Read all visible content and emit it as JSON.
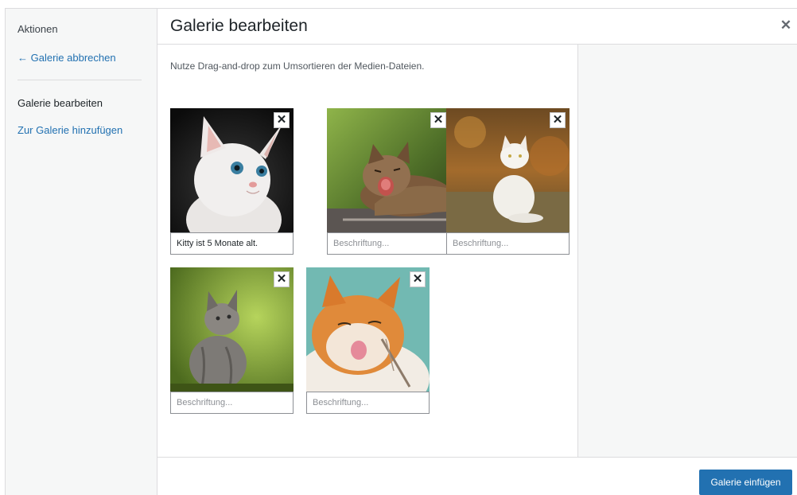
{
  "menu": {
    "heading": "Aktionen",
    "cancel_link": "← Galerie abbrechen",
    "active_item": "Galerie bearbeiten",
    "add_item": "Zur Galerie hinzufügen"
  },
  "header": {
    "title": "Galerie bearbeiten",
    "close_icon": "close-icon"
  },
  "main": {
    "instructions": "Nutze Drag-and-drop zum Umsortieren der Medien-Dateien."
  },
  "attachments": [
    {
      "caption_value": "Kitty ist 5 Monate alt.",
      "caption_placeholder": "Beschriftung...",
      "image": "white-kitten"
    },
    {
      "caption_value": "",
      "caption_placeholder": "Beschriftung...",
      "image": "tabby-cat-yawning"
    },
    {
      "caption_value": "",
      "caption_placeholder": "Beschriftung...",
      "image": "white-cat-sitting"
    },
    {
      "caption_value": "",
      "caption_placeholder": "Beschriftung...",
      "image": "grey-kitten"
    },
    {
      "caption_value": "",
      "caption_placeholder": "Beschriftung...",
      "image": "ginger-cat-licking"
    }
  ],
  "remove_label": "✕",
  "toolbar": {
    "insert_label": "Galerie einfügen"
  },
  "colors": {
    "accent": "#2271b1",
    "sidebar_bg": "#f6f7f7",
    "border": "#dcdcde"
  }
}
